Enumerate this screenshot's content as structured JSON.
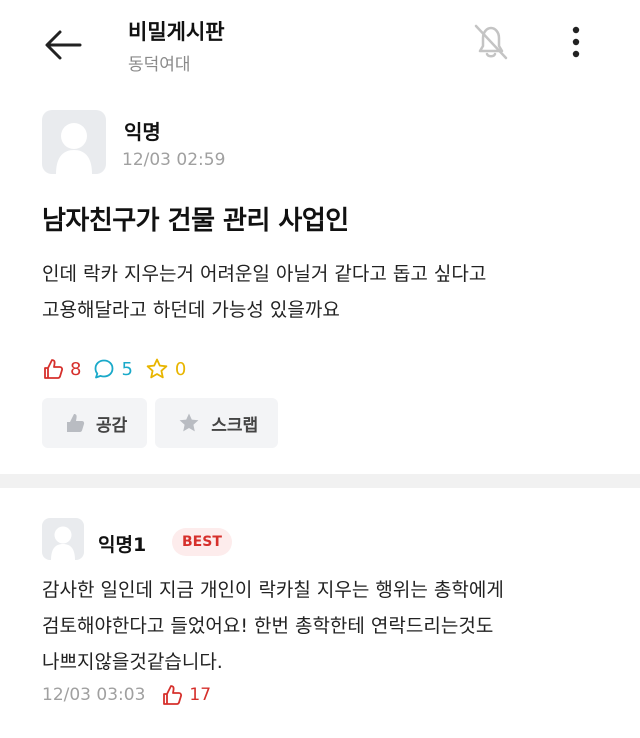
{
  "header": {
    "title": "비밀게시판",
    "subtitle": "동덕여대"
  },
  "post": {
    "author": "익명",
    "time": "12/03 02:59",
    "title": "남자친구가 건물 관리 사업인",
    "body_lines": [
      "인데 락카 지우는거 어려운일 아닐거 같다고 돕고 싶다고",
      "고용해달라고 하던데 가능성 있을까요"
    ],
    "stats": {
      "likes": "8",
      "comments": "5",
      "scraps": "0"
    },
    "actions": {
      "like_label": "공감",
      "scrap_label": "스크랩"
    }
  },
  "comment": {
    "author": "익명1",
    "badge": "BEST",
    "body_lines": [
      "감사한 일인데 지금 개인이 락카칠 지우는 행위는 총학에게",
      "검토해야한다고 들었어요! 한번 총학한테 연락드리는것도",
      "나쁘지않을것같습니다."
    ],
    "time": "12/03 03:03",
    "likes": "17"
  },
  "colors": {
    "like": "#d6302c",
    "comment": "#1aa9c9",
    "scrap": "#e8b500",
    "muted": "#a0a0a0"
  },
  "icons": {
    "back": "arrow-left-icon",
    "notification": "bell-off-icon",
    "more": "more-vertical-icon",
    "like": "thumbs-up-icon",
    "comment": "speech-bubble-icon",
    "scrap": "star-icon"
  }
}
